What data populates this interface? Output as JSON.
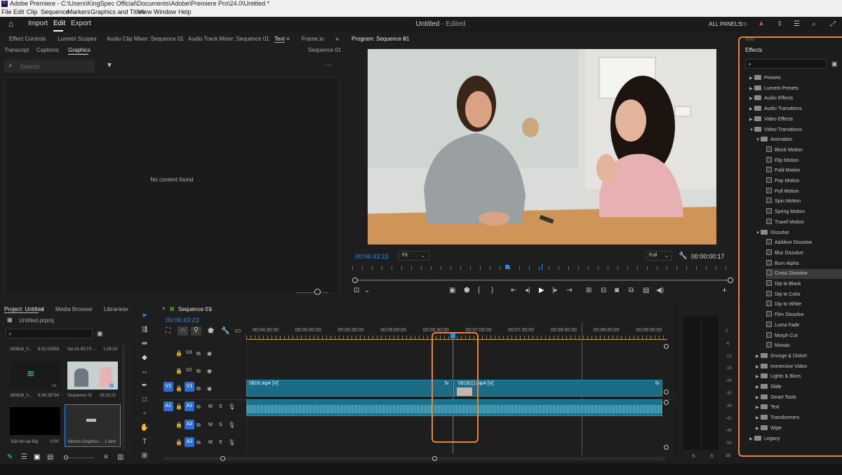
{
  "window": {
    "title": "Adobe Premiere - C:\\Users\\KingSpec Official\\Documents\\Adobe\\Premiere Pro\\24.0\\Untitled *",
    "app_icon": "Pr"
  },
  "menubar": [
    "File",
    "Edit",
    "Clip",
    "Sequence",
    "Markers",
    "Graphics and Titles",
    "View",
    "Window",
    "Help"
  ],
  "header": {
    "nav": [
      "Import",
      "Edit",
      "Export"
    ],
    "active": "Edit",
    "project_title": "Untitled",
    "project_status": "- Edited",
    "panels_label": "ALL PANELS"
  },
  "top_left_panel": {
    "tabs": [
      "Effect Controls",
      "Lumetri Scopes",
      "Audio Clip Mixer: Sequence 01",
      "Audio Track Mixer: Sequence 01",
      "Text",
      "Frame.io"
    ],
    "subtabs": [
      "Transcript",
      "Captions",
      "Graphics"
    ],
    "active_subtab": "Graphics",
    "sequence_label": "Sequence 01",
    "search_placeholder": "Search",
    "empty_text": "No content found"
  },
  "program_monitor": {
    "title": "Program: Sequence 01",
    "timecode": "00:06:43:23",
    "fit": "Fit",
    "quality": "Full",
    "duration": "00:00:00:17"
  },
  "effects_panel": {
    "top_label": "Info",
    "title": "Effects",
    "tree": [
      {
        "label": "Presets",
        "type": "folder",
        "level": 0,
        "expanded": false
      },
      {
        "label": "Lumetri Presets",
        "type": "folder",
        "level": 0,
        "expanded": false
      },
      {
        "label": "Audio Effects",
        "type": "folder",
        "level": 0,
        "expanded": false
      },
      {
        "label": "Audio Transitions",
        "type": "folder",
        "level": 0,
        "expanded": false
      },
      {
        "label": "Video Effects",
        "type": "folder",
        "level": 0,
        "expanded": false
      },
      {
        "label": "Video Transitions",
        "type": "folder",
        "level": 0,
        "expanded": true
      },
      {
        "label": "Animation",
        "type": "folder",
        "level": 1,
        "expanded": true
      },
      {
        "label": "Block Motion",
        "type": "effect",
        "level": 2
      },
      {
        "label": "Flip Motion",
        "type": "effect",
        "level": 2
      },
      {
        "label": "Fold Motion",
        "type": "effect",
        "level": 2
      },
      {
        "label": "Pop Motion",
        "type": "effect",
        "level": 2
      },
      {
        "label": "Pull Motion",
        "type": "effect",
        "level": 2
      },
      {
        "label": "Spin Motion",
        "type": "effect",
        "level": 2
      },
      {
        "label": "Spring Motion",
        "type": "effect",
        "level": 2
      },
      {
        "label": "Travel Motion",
        "type": "effect",
        "level": 2
      },
      {
        "label": "Dissolve",
        "type": "folder",
        "level": 1,
        "expanded": true
      },
      {
        "label": "Additive Dissolve",
        "type": "effect",
        "level": 2
      },
      {
        "label": "Blur Dissolve",
        "type": "effect",
        "level": 2
      },
      {
        "label": "Burn Alpha",
        "type": "effect",
        "level": 2
      },
      {
        "label": "Cross Dissolve",
        "type": "effect",
        "level": 2,
        "selected": true
      },
      {
        "label": "Dip to Black",
        "type": "effect",
        "level": 2
      },
      {
        "label": "Dip to Color",
        "type": "effect",
        "level": 2
      },
      {
        "label": "Dip to White",
        "type": "effect",
        "level": 2
      },
      {
        "label": "Film Dissolve",
        "type": "effect",
        "level": 2
      },
      {
        "label": "Luma Fade",
        "type": "effect",
        "level": 2
      },
      {
        "label": "Morph Cut",
        "type": "effect",
        "level": 2
      },
      {
        "label": "Mosaic",
        "type": "effect",
        "level": 2
      },
      {
        "label": "Grunge & Distort",
        "type": "folder",
        "level": 1,
        "expanded": false
      },
      {
        "label": "Immersive Video",
        "type": "folder",
        "level": 1,
        "expanded": false
      },
      {
        "label": "Lights & Blurs",
        "type": "folder",
        "level": 1,
        "expanded": false
      },
      {
        "label": "Slide",
        "type": "folder",
        "level": 1,
        "expanded": false
      },
      {
        "label": "Smart Tools",
        "type": "folder",
        "level": 1,
        "expanded": false
      },
      {
        "label": "Text",
        "type": "folder",
        "level": 1,
        "expanded": false
      },
      {
        "label": "Transformers",
        "type": "folder",
        "level": 1,
        "expanded": false
      },
      {
        "label": "Wipe",
        "type": "folder",
        "level": 1,
        "expanded": false
      },
      {
        "label": "Legacy",
        "type": "folder",
        "level": 0,
        "expanded": false
      }
    ]
  },
  "project_panel": {
    "tabs": [
      "Project: Untitled",
      "Media Browser",
      "Libraries"
    ],
    "file": "Untitled.prproj",
    "items": [
      {
        "name": "260816_0...",
        "meta": "9:32:02059"
      },
      {
        "name": "Vai trò IELTS ...",
        "meta": "1:28:23"
      },
      {
        "name": "260816_0...",
        "meta": "6:36:28734"
      },
      {
        "name": "Sequence 01",
        "meta": "16:23:21"
      },
      {
        "name": "Đặt tên tại đây",
        "meta": "0:00"
      },
      {
        "name": "Motion Graphics...",
        "meta": "1 item"
      }
    ]
  },
  "timeline": {
    "title": "Sequence 01",
    "timecode": "00:06:43:23",
    "ruler": [
      "00:04:30:00",
      "00:05:00:00",
      "00:05:30:00",
      "00:06:00:00",
      "00:06:30:00",
      "00:07:00:00",
      "00:07:30:00",
      "00:08:00:00",
      "00:08:30:00",
      "00:09:00:00"
    ],
    "tracks": {
      "video": [
        "V3",
        "V2",
        "V1"
      ],
      "audio": [
        "A1",
        "A2",
        "A3"
      ],
      "source_v": "V1",
      "source_a": "A1",
      "mute": "M",
      "solo": "S"
    },
    "clip1": "0816.mp4 [V]",
    "clip2": "0816(1).mp4 [V]",
    "fx": "fx"
  },
  "meter": {
    "ticks": [
      "0",
      "-6",
      "-12",
      "-18",
      "-24",
      "-30",
      "-36",
      "-42",
      "-48",
      "-54",
      "dB"
    ],
    "solo": [
      "S",
      "S"
    ]
  },
  "colors": {
    "highlight_orange": "#e8833a",
    "accent_blue": "#2d8ceb",
    "clip_blue": "#1b6a86",
    "clip_audio": "#1e6f8c"
  }
}
